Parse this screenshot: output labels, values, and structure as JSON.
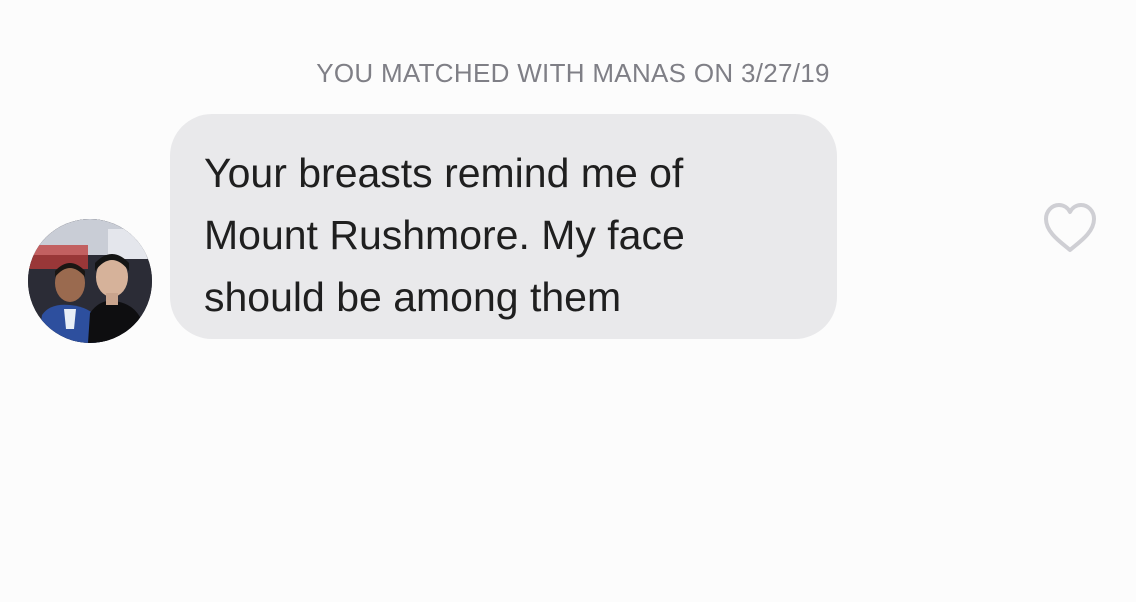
{
  "chat": {
    "match_banner": "YOU MATCHED WITH MANAS ON 3/27/19",
    "messages": [
      {
        "text": "Your breasts remind me of\nMount Rushmore. My face\nshould be among them",
        "avatar_icon": "profile-photo",
        "like_icon": "heart-outline-icon"
      }
    ]
  },
  "colors": {
    "background": "#fcfcfc",
    "bubble": "#e9e9eb",
    "banner_text": "#7f7f86",
    "message_text": "#1f1f1f",
    "heart_outline": "#cfcfd4"
  }
}
